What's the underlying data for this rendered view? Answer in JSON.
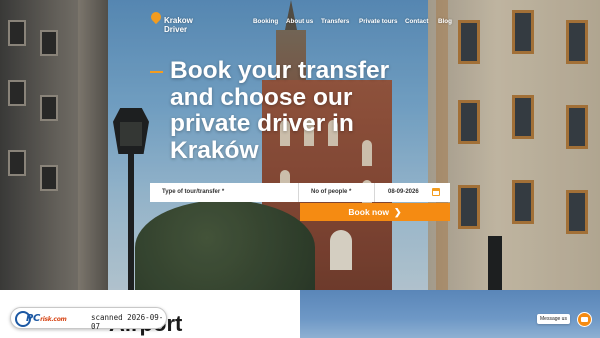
{
  "brand": {
    "logo_line1": "Krakow",
    "logo_line2": "Driver",
    "accent": "#f39c1f"
  },
  "nav": {
    "items": [
      {
        "label": "Booking"
      },
      {
        "label": "About us"
      },
      {
        "label": "Transfers"
      },
      {
        "label": "Private tours"
      },
      {
        "label": "Contact"
      },
      {
        "label": "Blog"
      }
    ]
  },
  "hero": {
    "headline": "Book your transfer and choose our private driver in Kraków"
  },
  "booking_form": {
    "type_field": "Type of tour/transfer *",
    "people_field": "No of people *",
    "date_value": "08-09-2026",
    "submit_label": "Book now",
    "button_color": "#f58b12"
  },
  "section": {
    "title": "Airport"
  },
  "watermark": {
    "brand": "PC",
    "brand_suffix": "risk.com",
    "text": "scanned 2026-09-07"
  },
  "chat": {
    "label": "Message us",
    "icon": "chat-bubble-icon"
  }
}
